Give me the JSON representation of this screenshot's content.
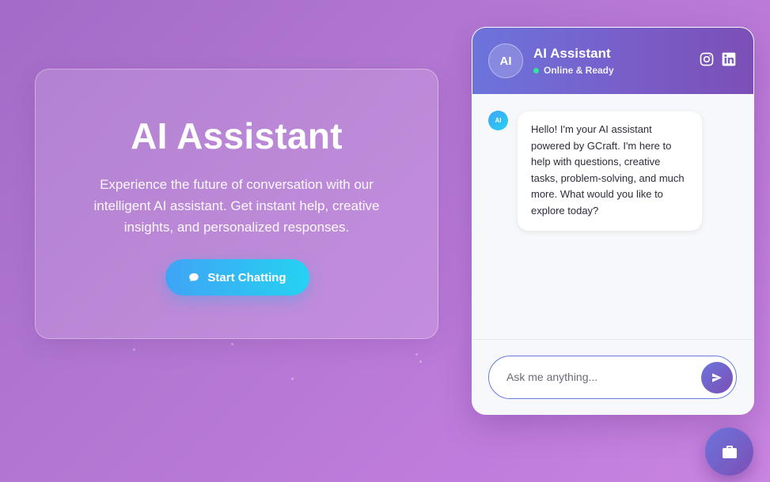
{
  "hero": {
    "title": "AI Assistant",
    "description": "Experience the future of conversation with our intelligent AI assistant. Get instant help, creative insights, and personalized responses.",
    "button_label": "Start Chatting",
    "button_icon": "chat-bubble-icon"
  },
  "chat": {
    "avatar_text": "AI",
    "title": "AI Assistant",
    "status": "Online & Ready",
    "status_color": "#2ee59d",
    "header_icons": [
      "instagram-icon",
      "linkedin-icon"
    ],
    "messages": [
      {
        "sender": "AI",
        "text": "Hello! I'm your AI assistant powered by GCraft. I'm here to help with questions, creative tasks, problem-solving, and much more. What would you like to explore today?"
      }
    ],
    "input_placeholder": "Ask me anything...",
    "input_value": "",
    "send_icon": "send-icon"
  },
  "fab": {
    "icon": "briefcase-icon"
  },
  "colors": {
    "accent": "#6c74dc",
    "accent_dark": "#7b4fb6",
    "cta": "#25d2f1",
    "background": "#b277d2"
  }
}
